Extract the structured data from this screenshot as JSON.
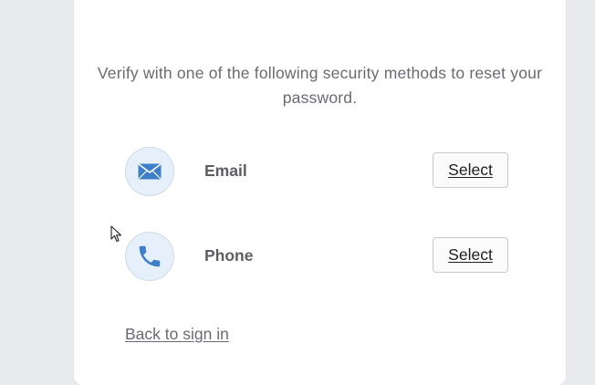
{
  "instruction": "Verify with one of the following security methods to reset your password.",
  "methods": [
    {
      "label": "Email",
      "icon": "envelope-icon",
      "select_label": "Select"
    },
    {
      "label": "Phone",
      "icon": "phone-icon",
      "select_label": "Select"
    }
  ],
  "back_link": "Back to sign in",
  "colors": {
    "icon_background": "#e6f0fb",
    "icon_blue": "#3f7fc9",
    "text_gray": "#6a6a72",
    "page_background": "#e9eaee"
  }
}
